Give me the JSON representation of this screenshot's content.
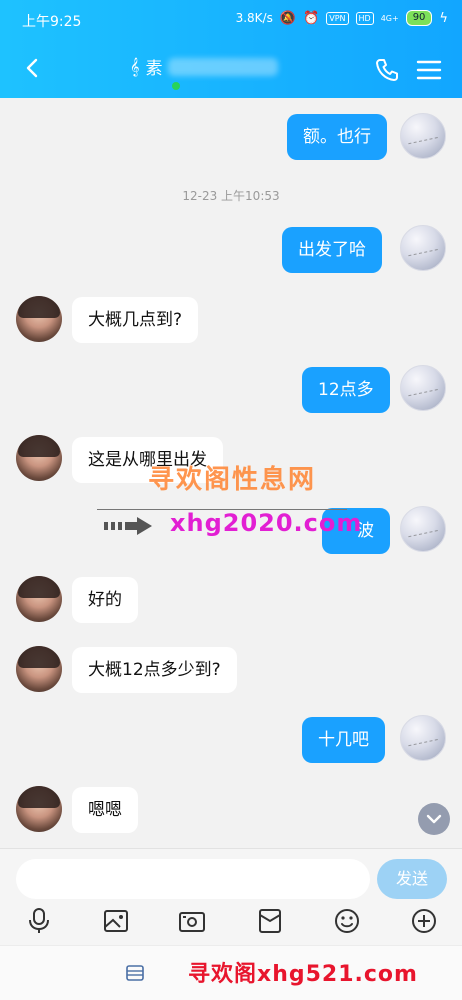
{
  "status_bar": {
    "time": "上午9:25",
    "speed": "3.8K/s",
    "network": "VPN",
    "hd": "HD",
    "signal": "4G+",
    "battery": "90"
  },
  "header": {
    "title_visible": "素"
  },
  "messages": {
    "m1": "额。也行",
    "timestamp": "12-23 上午10:53",
    "m2": "出发了哈",
    "m3": "大概几点到?",
    "m4": "12点多",
    "m5": "这是从哪里出发",
    "m6": "波",
    "m7": "好的",
    "m8": "大概12点多少到?",
    "m9": "十几吧",
    "m10": "嗯嗯"
  },
  "watermark": {
    "title": "寻欢阁性息网",
    "url": "xhg2020.com",
    "bottom": "寻欢阁xhg521.com"
  },
  "input": {
    "placeholder": "",
    "send_label": "发送"
  },
  "colors": {
    "accent": "#1aa1ff",
    "header_start": "#1ec2ff",
    "send_disabled": "#9dd2f5"
  }
}
